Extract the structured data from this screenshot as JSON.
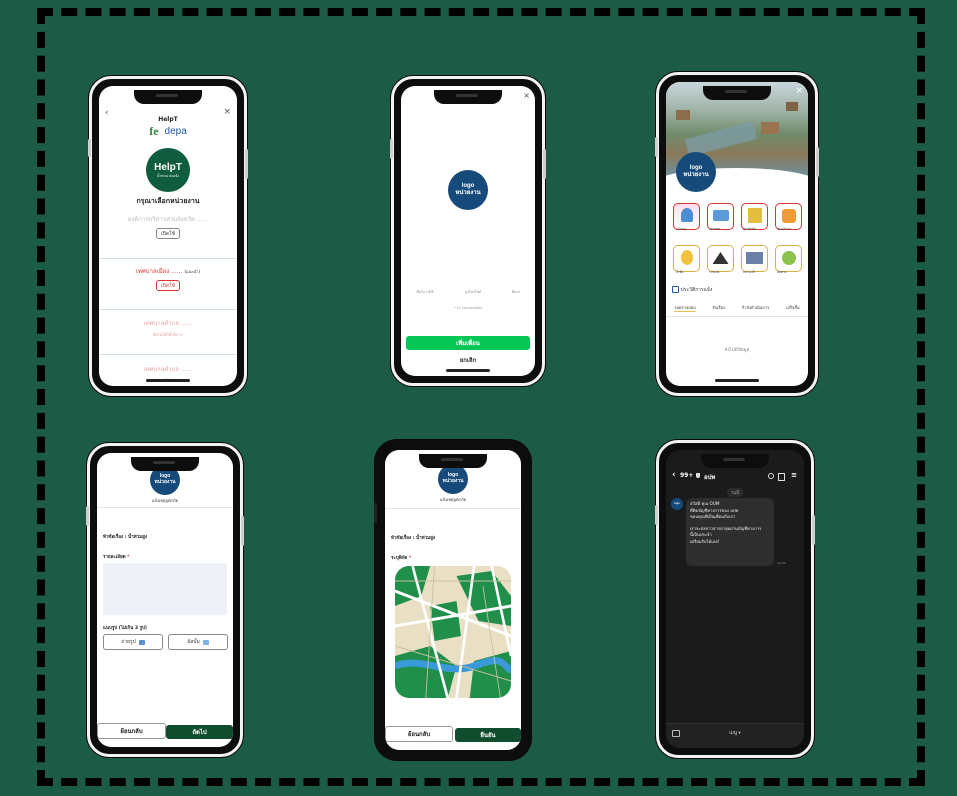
{
  "colors": {
    "background": "#1c5c47",
    "logo_blue": "#154a7a",
    "brand_green": "#0f5c3e",
    "line_green": "#06c755"
  },
  "logo_label": {
    "line1": "logo",
    "line2": "หน่วยงาน"
  },
  "phone1": {
    "header_title": "HelpT",
    "header_subtitle": "",
    "brand_left": "fe",
    "brand_right": "depa",
    "helpt_title": "HelpT",
    "helpt_sub": "น้ำท่วม ส่งแจ้ง",
    "heading": "กรุณาเลือกหน่วยงาน",
    "orgs": [
      {
        "name": "องค์การบริหารส่วนจังหวัด ......",
        "button": "เปิดใช้"
      },
      {
        "name": "เทศบาลเมือง ......",
        "tag": "(แนะนำ)",
        "button": "เปิดใช้"
      },
      {
        "name": "เทศบาลตำบล ......",
        "note": "ยังไม่ได้ให้บริการ"
      },
      {
        "name": "เทศบาลตำบล ......",
        "note": "ยังไม่ได้ให้บริการ"
      }
    ]
  },
  "phone2": {
    "close_icon": "×",
    "permissions": [
      "ชื่อใน LINE",
      "รูปโปรไฟล์",
      "อีเมล"
    ],
    "company": "• LY Corporation",
    "allow_button": "เพิ่มเพื่อน",
    "cancel_button": "ยกเลิก"
  },
  "phone3": {
    "services": [
      "แจ้งเหตุ",
      "จุดอพยพ",
      "ศูนย์พักพิง",
      "ของบริจาค",
      "น้ำดื่ม",
      "รถรับส่ง",
      "สถานะน้ำ",
      "ติดตาม"
    ],
    "section_label": "ประวัติการแจ้ง",
    "tabs": [
      "รอตรวจสอบ",
      "รับเรื่อง",
      "กำลังดำเนินการ",
      "เสร็จสิ้น"
    ],
    "empty_text": "ยังไม่มีข้อมูล"
  },
  "phone4": {
    "subtitle": "แจ้งเหตุอุทกภัย",
    "topic": "หัวข้อเรื่อง : น้ำท่วมสูง",
    "detail_label": "รายละเอียด",
    "attach_label": "แนบรูป (ไม่เกิน 3 รูป)",
    "camera_button": "ถ่ายรูป",
    "gallery_button": "อัลบั้ม",
    "back_button": "ย้อนกลับ",
    "next_button": "ถัดไป"
  },
  "phone5": {
    "subtitle": "แจ้งเหตุอุทกภัย",
    "topic": "หัวข้อเรื่อง : น้ำท่วมสูง",
    "location_label": "ระบุพิกัด",
    "back_button": "ย้อนกลับ",
    "submit_button": "ยืนยัน"
  },
  "phone6": {
    "unread": "99+",
    "chat_name": "อปท",
    "date_chip": "วันนี้",
    "message": [
      "สวัสดี คุณ OUM",
      "ที่ติดบัญชีทางการของ อปท",
      "ขอบคุณที่เป็นเพื่อนกับเรา",
      "",
      "เราจะส่งข่าวสารล่าสุดผ่านบัญชีทางการ",
      "นี้เป็นประจำ",
      "เตรียมรับได้เลย!"
    ],
    "time": "10:00",
    "menu_label": "เมนู ▾"
  }
}
